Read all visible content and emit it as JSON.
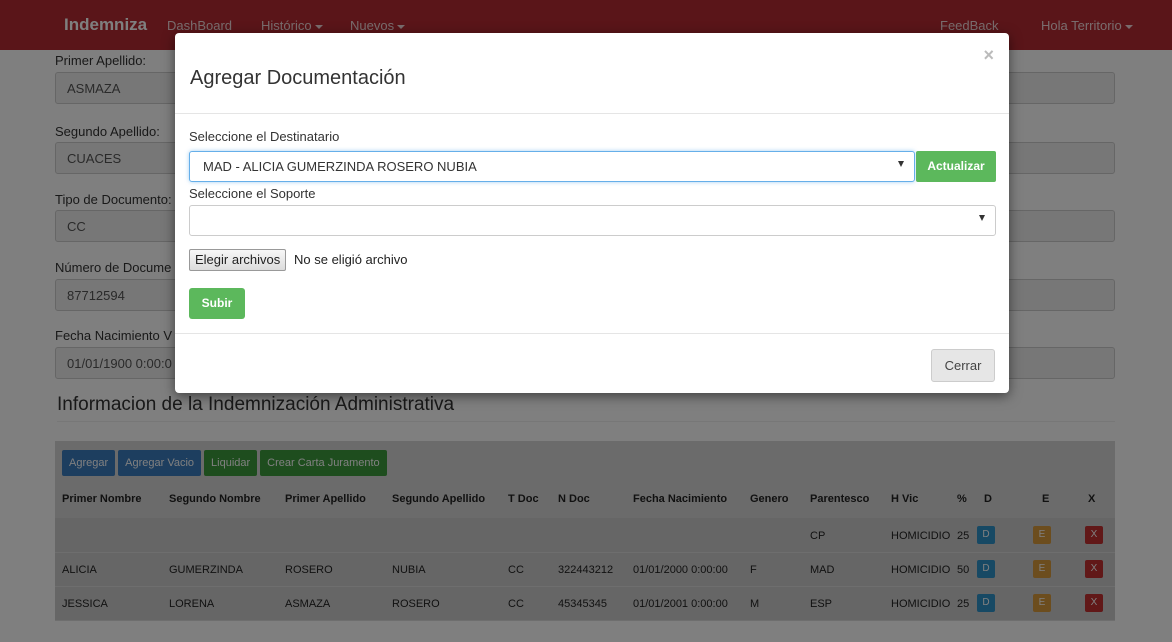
{
  "navbar": {
    "brand": "Indemniza",
    "dashboard": "DashBoard",
    "historico": "Histórico",
    "nuevos": "Nuevos",
    "feedback": "FeedBack",
    "user": "Hola Territorio"
  },
  "form": {
    "primer_apellido_label": "Primer Apellido:",
    "primer_apellido_value": "ASMAZA",
    "segundo_apellido_label": "Segundo Apellido:",
    "segundo_apellido_value": "CUACES",
    "tipo_documento_label": "Tipo de Documento:",
    "tipo_documento_value": "CC",
    "numero_documento_label": "Número de Docume",
    "numero_documento_value": "87712594",
    "fecha_nacimiento_label": "Fecha Nacimiento V",
    "fecha_nacimiento_value": "01/01/1900 0:00:0"
  },
  "section": {
    "title": "Informacion de la Indemnización Administrativa"
  },
  "toolbar": {
    "agregar": "Agregar",
    "agregar_vacio": "Agregar Vacio",
    "liquidar": "Liquidar",
    "crear_carta": "Crear Carta Juramento"
  },
  "table": {
    "headers": [
      "Primer Nombre",
      "Segundo Nombre",
      "Primer Apellido",
      "Segundo Apellido",
      "T Doc",
      "N Doc",
      "Fecha Nacimiento",
      "Genero",
      "Parentesco",
      "H Vic",
      "%",
      "D",
      "E",
      "X"
    ],
    "rows": [
      [
        "",
        "",
        "",
        "",
        "",
        "",
        "",
        "",
        "CP",
        "HOMICIDIO",
        "25",
        "D",
        "E",
        "X"
      ],
      [
        "ALICIA",
        "GUMERZINDA",
        "ROSERO",
        "NUBIA",
        "CC",
        "322443212",
        "01/01/2000 0:00:00",
        "F",
        "MAD",
        "HOMICIDIO",
        "50",
        "D",
        "E",
        "X"
      ],
      [
        "JESSICA",
        "LORENA",
        "ASMAZA",
        "ROSERO",
        "CC",
        "45345345",
        "01/01/2001 0:00:00",
        "M",
        "ESP",
        "HOMICIDIO",
        "25",
        "D",
        "E",
        "X"
      ]
    ]
  },
  "modal": {
    "title": "Agregar Documentación",
    "close": "×",
    "destinatario_label": "Seleccione el Destinatario",
    "destinatario_value": "MAD - ALICIA GUMERZINDA ROSERO NUBIA",
    "actualizar": "Actualizar",
    "soporte_label": "Seleccione el Soporte",
    "soporte_value": "",
    "file_button": "Elegir archivos",
    "file_text": "No se eligió archivo",
    "subir": "Subir",
    "cerrar": "Cerrar"
  }
}
